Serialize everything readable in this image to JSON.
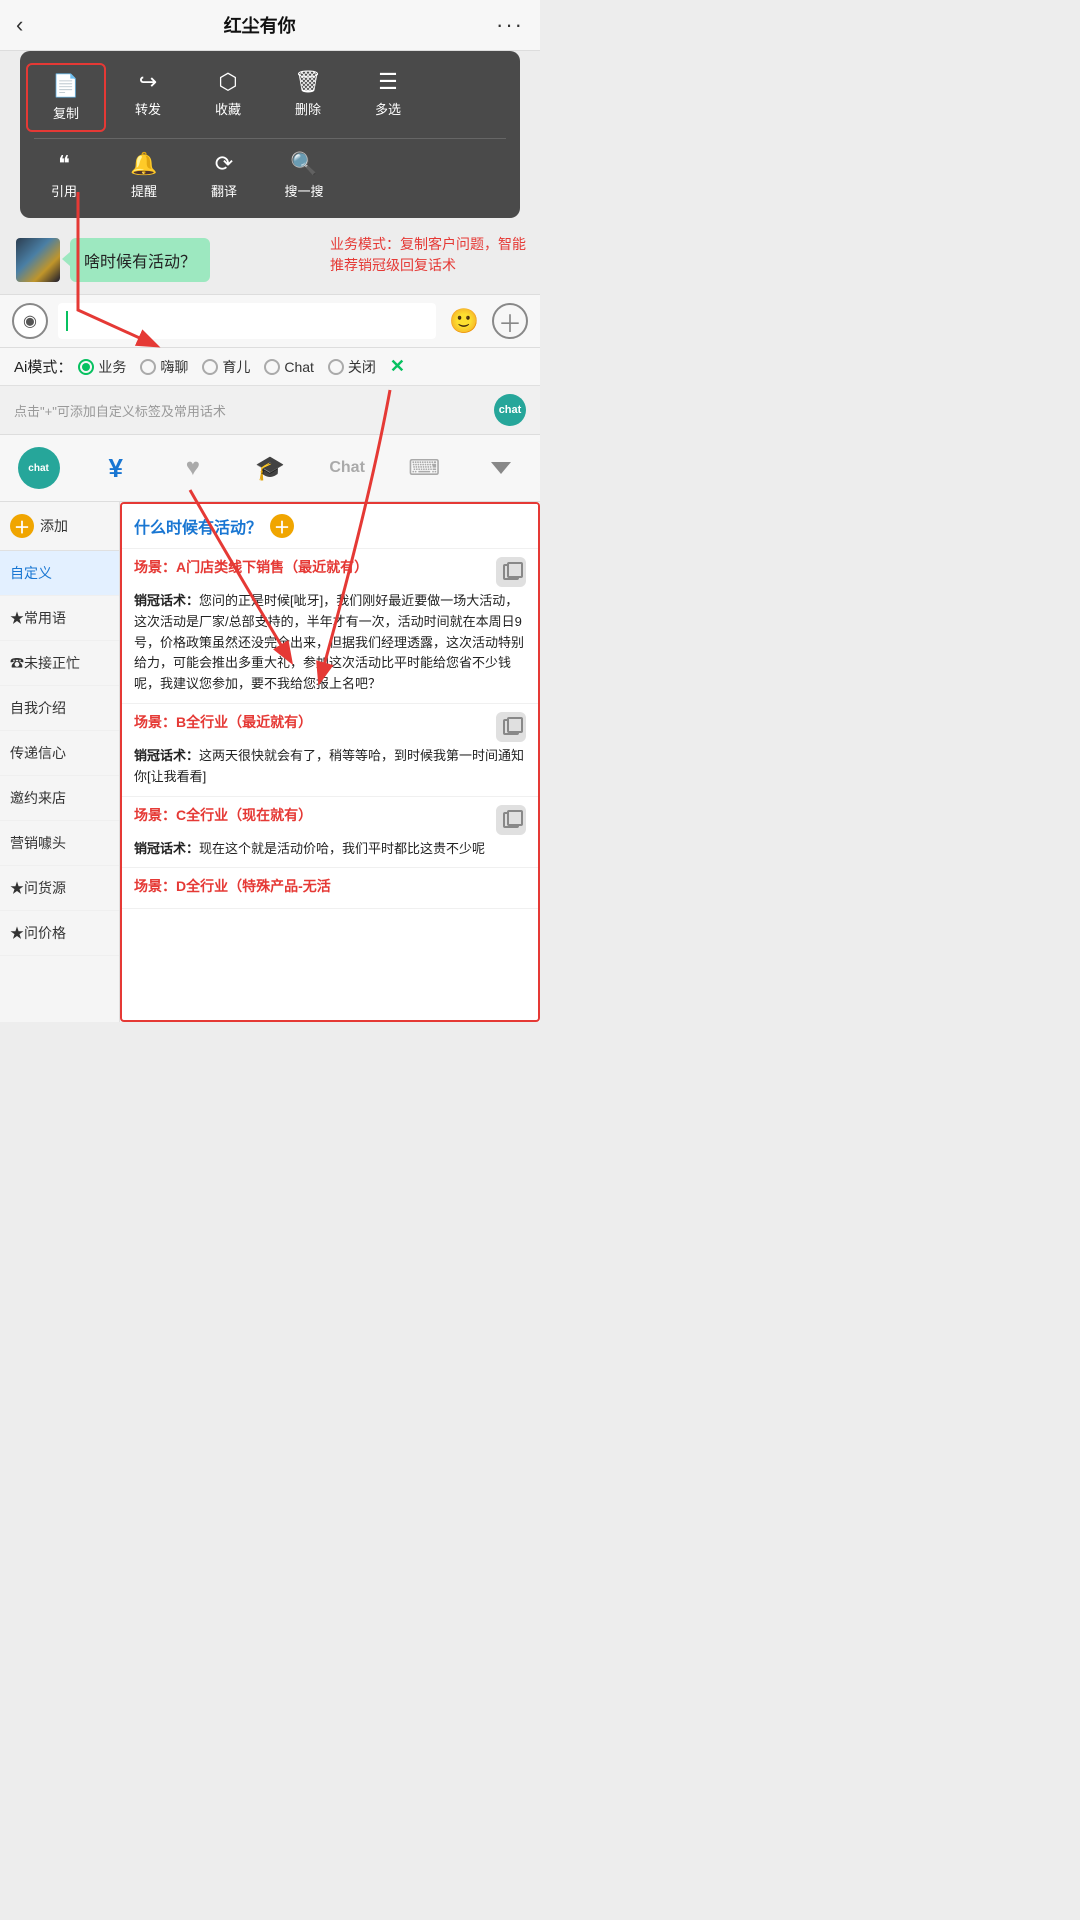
{
  "header": {
    "back": "‹",
    "title": "红尘有你",
    "more": "···"
  },
  "context_menu": {
    "row1": [
      {
        "icon": "📄",
        "label": "复制",
        "highlighted": true
      },
      {
        "icon": "↪",
        "label": "转发",
        "highlighted": false
      },
      {
        "icon": "🎁",
        "label": "收藏",
        "highlighted": false
      },
      {
        "icon": "🗑",
        "label": "删除",
        "highlighted": false
      },
      {
        "icon": "☰",
        "label": "多选",
        "highlighted": false
      }
    ],
    "row2": [
      {
        "icon": "❝",
        "label": "引用",
        "highlighted": false
      },
      {
        "icon": "🔔",
        "label": "提醒",
        "highlighted": false
      },
      {
        "icon": "⟳",
        "label": "翻译",
        "highlighted": false
      },
      {
        "icon": "🔍",
        "label": "搜一搜",
        "highlighted": false
      }
    ]
  },
  "chat": {
    "message": "啥时候有活动？"
  },
  "annotation": {
    "text": "业务模式：复制客户问题，智能推荐销冠级回复话术"
  },
  "input": {
    "placeholder": "",
    "cursor": "|"
  },
  "ai_modes": {
    "label": "Ai模式：",
    "options": [
      "业务",
      "嗨聊",
      "育儿",
      "Chat",
      "关闭"
    ],
    "active": "业务",
    "close_icon": "✕"
  },
  "hint_bar": {
    "text": "点击\"+\"可添加自定义标签及常用话术",
    "icon": "chat"
  },
  "toolbar": {
    "items": [
      {
        "type": "chat-logo",
        "label": "chat"
      },
      {
        "type": "icon",
        "icon": "¥",
        "color": "blue"
      },
      {
        "type": "icon",
        "icon": "♥",
        "color": "gray"
      },
      {
        "type": "icon",
        "icon": "🎓",
        "color": "gray"
      },
      {
        "type": "text",
        "icon": "Chat",
        "color": "gray"
      },
      {
        "type": "icon",
        "icon": "⌨",
        "color": "gray"
      },
      {
        "type": "arrow",
        "icon": "▼"
      }
    ]
  },
  "sidebar": {
    "add_label": "添加",
    "items": [
      {
        "label": "自定义",
        "active": true
      },
      {
        "label": "★常用语",
        "active": false
      },
      {
        "label": "☎未接正忙",
        "active": false
      },
      {
        "label": "自我介绍",
        "active": false
      },
      {
        "label": "传递信心",
        "active": false
      },
      {
        "label": "邀约来店",
        "active": false
      },
      {
        "label": "营销噱头",
        "active": false
      },
      {
        "label": "★问货源",
        "active": false
      },
      {
        "label": "★问价格",
        "active": false
      }
    ]
  },
  "panel": {
    "title": "什么时候有活动？",
    "scenarios": [
      {
        "title": "场景：A门店类线下销售（最近就有）",
        "content": "销冠话术：您问的正是时候[呲牙]，我们刚好最近要做一场大活动，这次活动是厂家/总部支持的，半年才有一次，活动时间就在本周日9号，价格政策虽然还没完全出来，但据我们经理透露，这次活动特别给力，可能会推出多重大礼，参加这次活动比平时能给您省不少钱呢，我建议您参加，要不我给您报上名吧？"
      },
      {
        "title": "场景：B全行业（最近就有）",
        "content": "销冠话术：这两天很快就会有了，稍等等哈，到时候我第一时间通知你[让我看看]"
      },
      {
        "title": "场景：C全行业（现在就有）",
        "content": "销冠话术：现在这个就是活动价哈，我们平时都比这贵不少呢"
      },
      {
        "title": "场景：D全行业（特殊产品-无活",
        "content": ""
      }
    ]
  }
}
